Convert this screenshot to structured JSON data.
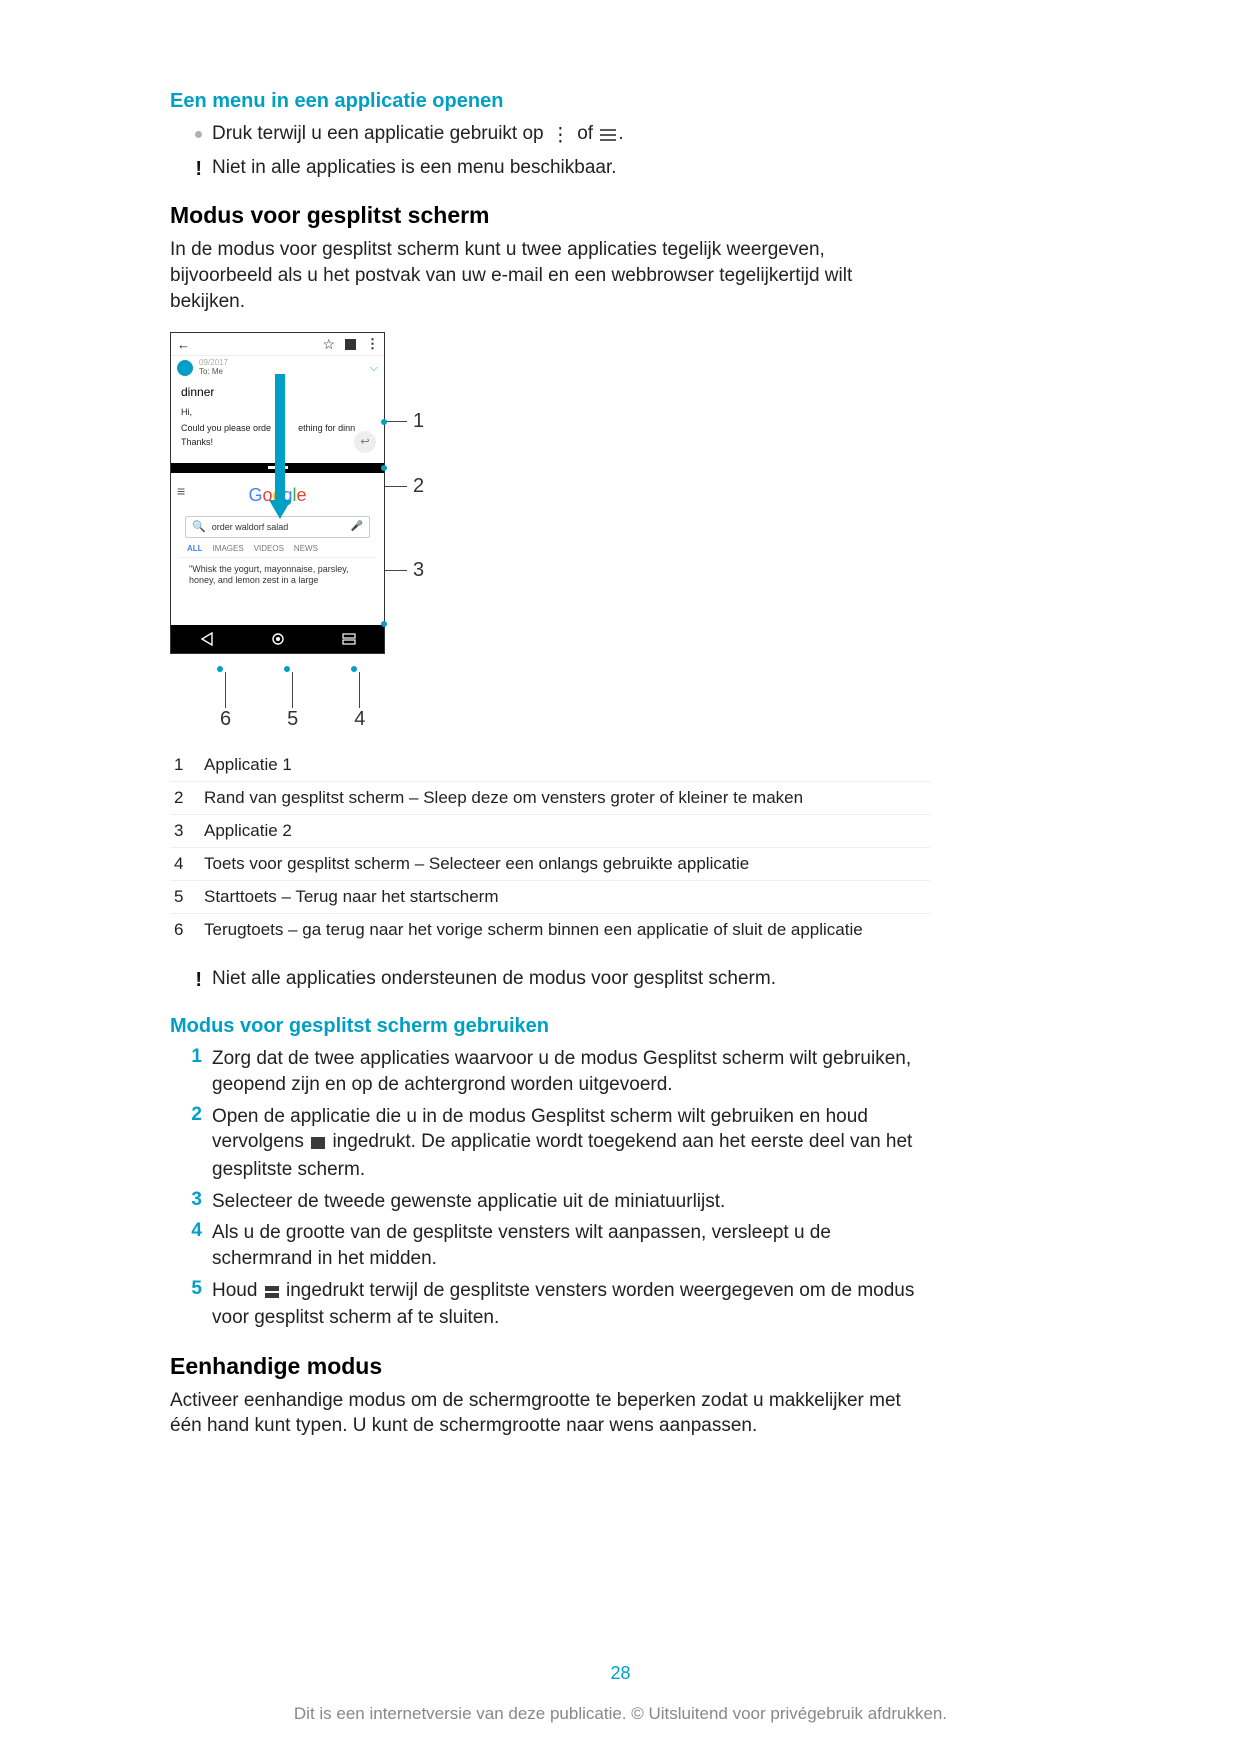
{
  "headings": {
    "open_menu": "Een menu in een applicatie openen",
    "split_mode": "Modus voor gesplitst scherm",
    "use_split": "Modus voor gesplitst scherm gebruiken",
    "one_handed": "Eenhandige modus"
  },
  "paragraphs": {
    "open_menu_line_a": "Druk terwijl u een applicatie gebruikt op ",
    "open_menu_line_b": " of ",
    "open_menu_line_c": ".",
    "open_menu_note": "Niet in alle applicaties is een menu beschikbaar.",
    "split_intro": "In de modus voor gesplitst scherm kunt u twee applicaties tegelijk weergeven, bijvoorbeeld als u het postvak van uw e-mail en een webbrowser tegelijkertijd wilt bekijken.",
    "split_note": "Niet alle applicaties ondersteunen de modus voor gesplitst scherm.",
    "one_handed_body": "Activeer eenhandige modus om de schermgrootte te beperken zodat u makkelijker met één hand kunt typen. U kunt de schermgrootte naar wens aanpassen."
  },
  "definitions": [
    {
      "n": "1",
      "t": "Applicatie 1"
    },
    {
      "n": "2",
      "t": "Rand van gesplitst scherm – Sleep deze om vensters groter of kleiner te maken"
    },
    {
      "n": "3",
      "t": "Applicatie 2"
    },
    {
      "n": "4",
      "t": "Toets voor gesplitst scherm – Selecteer een onlangs gebruikte applicatie"
    },
    {
      "n": "5",
      "t": "Starttoets – Terug naar het startscherm"
    },
    {
      "n": "6",
      "t": "Terugtoets – ga terug naar het vorige scherm binnen een applicatie of sluit de applicatie"
    }
  ],
  "steps": [
    "Zorg dat de twee applicaties waarvoor u de modus Gesplitst scherm wilt gebruiken, geopend zijn en op de achtergrond worden uitgevoerd.",
    "Open de applicatie die u in de modus Gesplitst scherm wilt gebruiken en houd vervolgens ■ ingedrukt. De applicatie wordt toegekend aan het eerste deel van het gesplitste scherm.",
    "Selecteer de tweede gewenste applicatie uit de miniatuurlijst.",
    "Als u de grootte van de gesplitste vensters wilt aanpassen, versleept u de schermrand in het midden.",
    "Houd ⬚ ingedrukt terwijl de gesplitste vensters worden weergegeven om de modus voor gesplitst scherm af te sluiten."
  ],
  "step_numbers": [
    "1",
    "2",
    "3",
    "4",
    "5"
  ],
  "diagram": {
    "topbar": {
      "back": "←",
      "star": "☆",
      "dots": "⋮"
    },
    "email": {
      "date": "09/2017",
      "to": "To: Me",
      "subject": "dinner",
      "hi": "Hi,",
      "body_a": "Could you please orde",
      "body_b": "ething for dinn",
      "thanks": "Thanks!"
    },
    "google": {
      "query": "order waldorf salad",
      "tabs": [
        "ALL",
        "IMAGES",
        "VIDEOS",
        "NEWS"
      ],
      "snippet": "\"Whisk the yogurt, mayonnaise, parsley, honey, and lemon zest in a large"
    },
    "right_labels": [
      "1",
      "2",
      "3"
    ],
    "bottom_labels": [
      "6",
      "5",
      "4"
    ]
  },
  "page_number": "28",
  "footer": "Dit is een internetversie van deze publicatie. © Uitsluitend voor privégebruik afdrukken."
}
